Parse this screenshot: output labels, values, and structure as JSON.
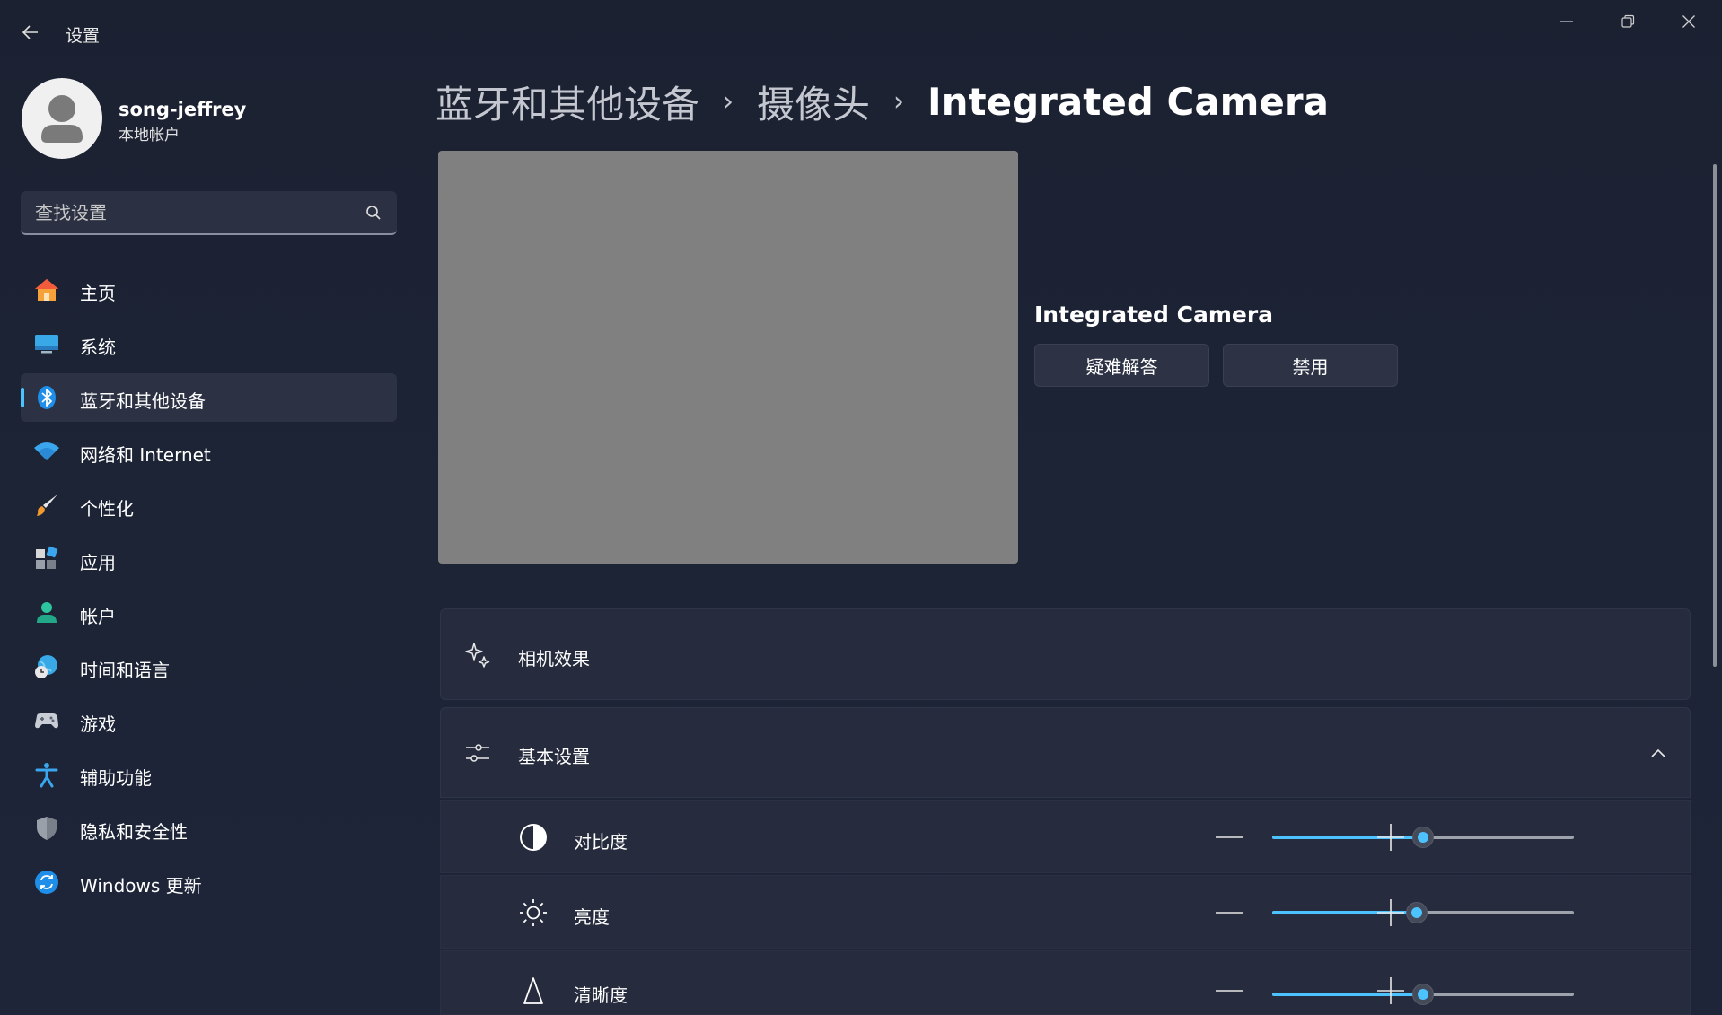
{
  "window": {
    "title": "设置",
    "minimize_icon": "minimize-icon",
    "restore_icon": "restore-icon",
    "close_icon": "close-icon"
  },
  "user": {
    "name": "song-jeffrey",
    "account_type": "本地帐户"
  },
  "search": {
    "placeholder": "查找设置"
  },
  "sidebar": {
    "items": [
      {
        "label": "主页",
        "icon": "home-icon"
      },
      {
        "label": "系统",
        "icon": "system-display-icon"
      },
      {
        "label": "蓝牙和其他设备",
        "icon": "bluetooth-icon",
        "active": true
      },
      {
        "label": "网络和 Internet",
        "icon": "wifi-icon"
      },
      {
        "label": "个性化",
        "icon": "paintbrush-icon"
      },
      {
        "label": "应用",
        "icon": "apps-icon"
      },
      {
        "label": "帐户",
        "icon": "person-icon"
      },
      {
        "label": "时间和语言",
        "icon": "globe-clock-icon"
      },
      {
        "label": "游戏",
        "icon": "gamepad-icon"
      },
      {
        "label": "辅助功能",
        "icon": "accessibility-icon"
      },
      {
        "label": "隐私和安全性",
        "icon": "shield-icon"
      },
      {
        "label": "Windows 更新",
        "icon": "windows-update-icon"
      }
    ]
  },
  "breadcrumb": {
    "items": [
      "蓝牙和其他设备",
      "摄像头",
      "Integrated Camera"
    ],
    "separator": "›"
  },
  "camera": {
    "name": "Integrated Camera",
    "troubleshoot_label": "疑难解答",
    "disable_label": "禁用"
  },
  "sections": {
    "effects_label": "相机效果",
    "basic_label": "基本设置"
  },
  "sliders": [
    {
      "label": "对比度",
      "icon": "contrast-icon",
      "value": 50
    },
    {
      "label": "亮度",
      "icon": "brightness-icon",
      "value": 48
    },
    {
      "label": "清晰度",
      "icon": "sharpness-icon",
      "value": 50
    }
  ],
  "colors": {
    "accent": "#4cc2ff",
    "background": "#1c2232",
    "card": "#262c3d",
    "preview": "#808080"
  }
}
